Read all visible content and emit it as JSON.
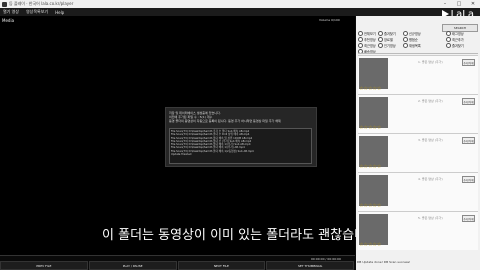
{
  "window": {
    "title": "등 플레이 · 한국어 lala.co.kr/player"
  },
  "menu": [
    "열기 영상",
    "영상목록보기",
    "Help"
  ],
  "logo": "LaLa",
  "media": {
    "label": "Media",
    "volume": "Volume 0/100",
    "timecode": "00:00:00 / 00:00:00",
    "progress": 0
  },
  "dialog": {
    "msg1": "저장 및 데이터베이스 생성중에 있습니다.",
    "msg2": "이전에 추가된 파일 수 : 5(1) 개수",
    "msg3": "동영 폴더의 동영상이 자동으로 등록이 됩니다. 동영 추가 하시려면 동영상 파일 추가 해제",
    "log": [
      "File Scan(73) D:\\Desktop\\Samth 추가 수 폴더 Sub 배속 AB.mp4",
      "File Scan(73) D:\\Desktop\\Samth 폴더 수 Drill 상위 배속 AB.mp4",
      "File Scan(73) D:\\Desktop\\Samth 폴더 배속 일 상위 1DOM AB.mp4",
      "File Scan(73) D:\\Desktop\\Samth 폴더 수 (추가) Sub 배속 AB.mp4",
      "File Scan(73) D:\\Desktop\\Samth 폴더 배속 1/(추가) Sub AB.mp4",
      "File Scan(73) D:\\Desktop\\Samth 폴더 배속 1/(추가) AB.mp4",
      "File Scan(73) D:\\Desktop\\Samth 폴더 배속 1(2동영상) Sub AB.mp4",
      "Update finished"
    ]
  },
  "subtitle": "이 폴더는 동영상이 이미 있는 폴더라도 괜찮습니다",
  "buttons": [
    "PREV FILE",
    "PLAY / PAUSE",
    "NEXT FILE",
    "SET THUMBNAIL"
  ],
  "sidebar": {
    "search_label": "SEARCH",
    "categories": [
      "전체보기",
      "추천영상",
      "최근영상",
      "배속영상",
      "즐겨찾기",
      "장르별",
      "인기영상",
      "신규영상",
      "평점순",
      "재생목록",
      "태그영상",
      "최근추가",
      "즐겨찾기"
    ],
    "cards": [
      {
        "name": "1. 좋은 영상 (추가)",
        "button": "추가/삭제",
        "stars": "☆☆☆☆☆"
      },
      {
        "name": "2. 좋은 영상 (추가)",
        "button": "추가/삭제",
        "stars": "☆☆☆☆☆"
      },
      {
        "name": "3. 좋은 영상 (추가)",
        "button": "추가/삭제",
        "stars": "☆☆☆☆☆"
      },
      {
        "name": "4. 좋은 영상 (추가)",
        "button": "추가/삭제",
        "stars": "☆☆☆☆☆"
      },
      {
        "name": "5. 좋은 영상 (추가)",
        "button": "추가/삭제",
        "stars": "☆☆☆☆☆"
      }
    ],
    "status": "DB Update done! DB Scan success!"
  }
}
